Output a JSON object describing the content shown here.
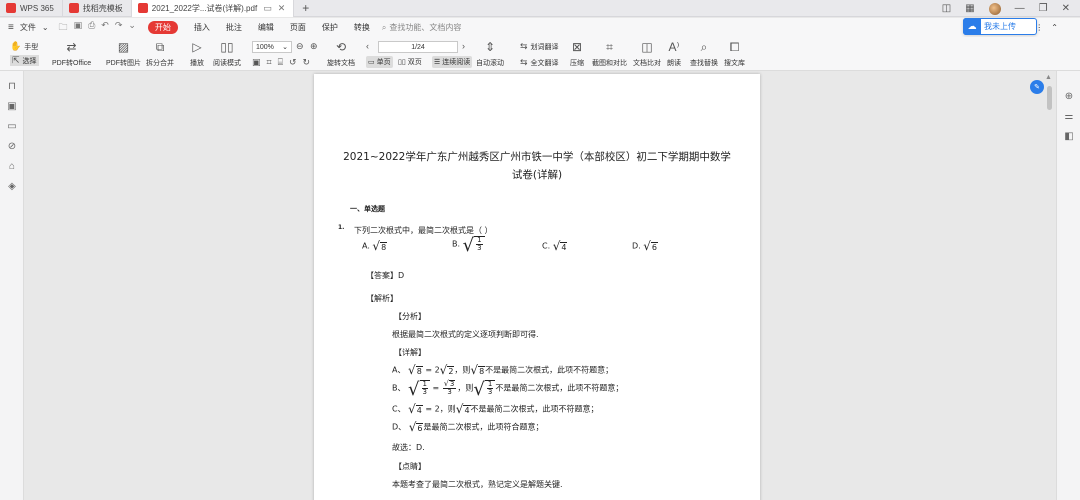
{
  "tabs": [
    {
      "label": "WPS 365"
    },
    {
      "label": "找稻壳模板"
    },
    {
      "label": "2021_2022学...试卷(详解).pdf"
    }
  ],
  "menubar": {
    "file": "文件",
    "items": [
      "开始",
      "插入",
      "批注",
      "编辑",
      "页面",
      "保护",
      "转换"
    ],
    "active": "开始",
    "search_placeholder": "查找功能、文档内容",
    "unsaved": "未上",
    "upload": "我未上传"
  },
  "ribbon": {
    "hand": "手型",
    "select": "选择",
    "pdf_to_office": "PDF转Office",
    "pdf_to_image": "PDF转图片",
    "split_merge": "拆分合并",
    "play": "播放",
    "read_mode": "阅读模式",
    "zoom": "100%",
    "page_indicator": "1/24",
    "rotate": "旋转文档",
    "single": "单页",
    "double": "双页",
    "continuous": "连续阅读",
    "auto_scroll": "自动滚动",
    "translate": "划词翻译",
    "full_translate": "全文翻译",
    "compress": "压缩",
    "screenshot": "截图和对比",
    "compare": "文档比对",
    "read_aloud": "朗读",
    "find_replace": "查找替换",
    "search_lib": "搜文库"
  },
  "document": {
    "title_line1": "2021~2022学年广东广州越秀区广州市铁一中学（本部校区）初二下学期期中数学",
    "title_line2": "试卷(详解)",
    "section": "一、单选题",
    "q_number": "1.",
    "question": "下列二次根式中，最简二次根式是（        ）",
    "options": [
      "A.",
      "B.",
      "C.",
      "D."
    ],
    "option_vals": [
      "8",
      "1",
      "3",
      "4",
      "6"
    ],
    "answer": "【答案】D",
    "analysis": "【解析】",
    "fenxi": "【分析】",
    "fenxi_text": "根据最简二次根式的定义逐项判断即可得.",
    "xiangjie": "【详解】",
    "lineA": [
      "A、",
      "8",
      " = 2",
      "2",
      "，则",
      "8",
      "不是最简二次根式，此项不符题意；"
    ],
    "lineB": [
      "B、",
      "1",
      "3",
      " = ",
      "3",
      "3",
      "，则",
      "1",
      "3",
      "不是最简二次根式，此项不符题意；"
    ],
    "lineC": [
      "C、",
      "4",
      " = 2，则",
      "4",
      "不是最简二次根式，此项不符题意；"
    ],
    "lineD": [
      "D、",
      "6",
      "是最简二次根式，此项符合题意；"
    ],
    "guxuan": "故选：D.",
    "dianjing": "【点睛】",
    "dianjing_text": "本题考查了最简二次根式，熟记定义是解题关键."
  },
  "colors": {
    "accent": "#e53935",
    "blue": "#2b7de9"
  }
}
